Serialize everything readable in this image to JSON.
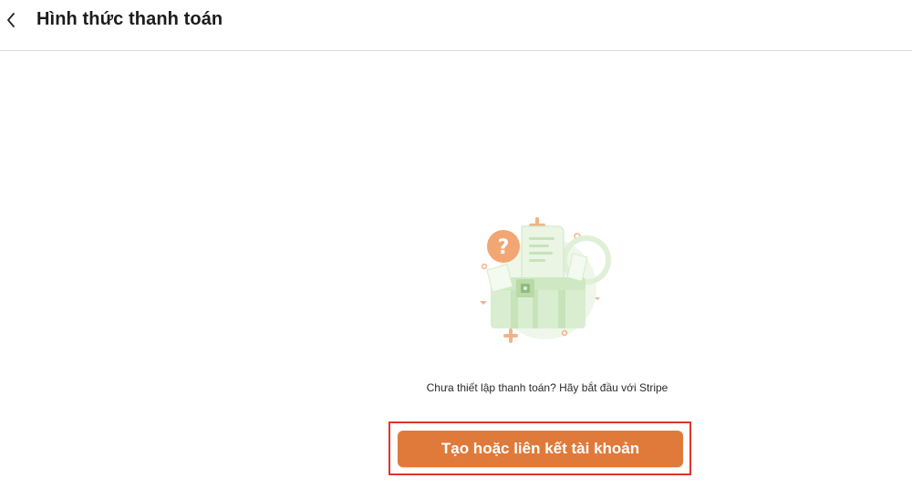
{
  "header": {
    "title": "Hình thức thanh toán",
    "back_icon": "chevron-left-icon"
  },
  "empty_state": {
    "illustration": "payment-setup-illustration",
    "message": "Chưa thiết lập thanh toán? Hãy bắt đầu với Stripe"
  },
  "cta": {
    "label": "Tạo hoặc liên kết tài khoản",
    "color": "#e07a3a",
    "highlight_color": "#e0342a"
  }
}
